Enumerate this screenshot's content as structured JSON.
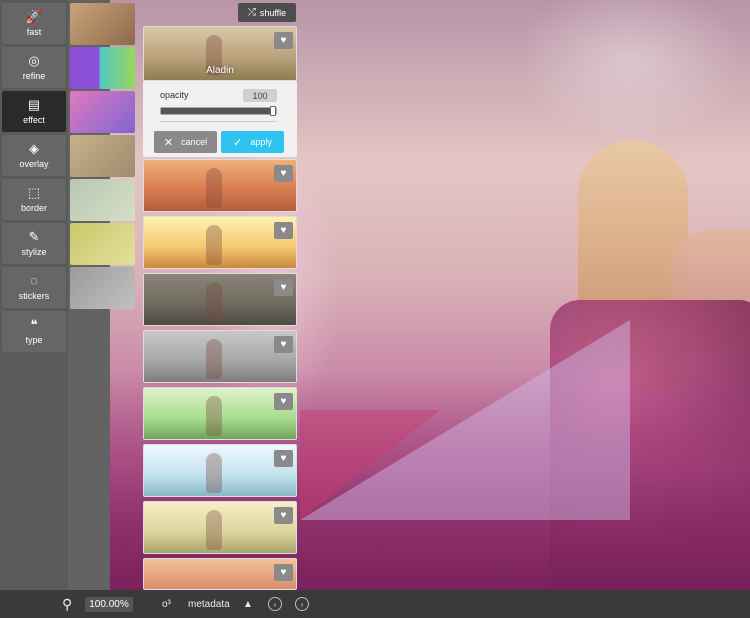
{
  "toolbar": {
    "items": [
      {
        "label": "fast",
        "icon": "rocket-icon",
        "glyph": "🚀"
      },
      {
        "label": "refine",
        "icon": "refine-icon",
        "glyph": "◎"
      },
      {
        "label": "effect",
        "icon": "film-icon",
        "glyph": "▤",
        "active": true
      },
      {
        "label": "overlay",
        "icon": "layers-icon",
        "glyph": "◈"
      },
      {
        "label": "border",
        "icon": "border-icon",
        "glyph": "⬚"
      },
      {
        "label": "stylize",
        "icon": "brush-icon",
        "glyph": "✎"
      },
      {
        "label": "stickers",
        "icon": "sticker-icon",
        "glyph": "◌"
      },
      {
        "label": "type",
        "icon": "quote-icon",
        "glyph": "❝"
      }
    ]
  },
  "effects_panel": {
    "shuffle_label": "shuffle",
    "shuffle_glyph": "⤮",
    "selected_effect": "Aladin",
    "opacity_label": "opacity",
    "opacity_value": "100",
    "opacity_fraction": 1.0,
    "cancel_label": "cancel",
    "cancel_glyph": "✕",
    "apply_label": "apply",
    "apply_glyph": "✓",
    "heart_glyph": "♥"
  },
  "statusbar": {
    "zoom_icon_glyph": "⚲",
    "zoom_value": "100.00%",
    "metadata_glyph": "o³",
    "metadata_label": "metadata",
    "up_glyph": "▲",
    "prev_glyph": "‹",
    "next_glyph": "›"
  },
  "colors": {
    "apply_button": "#2fc4f0",
    "active_tool": "#2a2a2a",
    "toolbar_bg": "#5a5a5a"
  }
}
